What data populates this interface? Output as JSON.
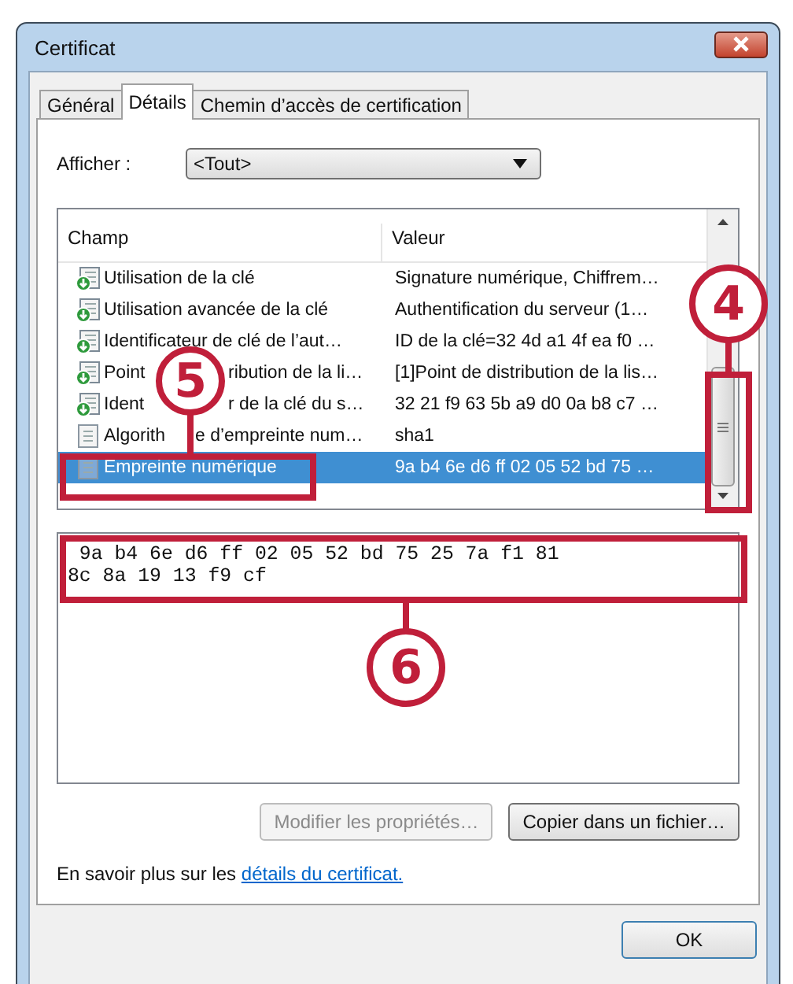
{
  "window": {
    "title": "Certificat"
  },
  "tabs": [
    {
      "label": "Général",
      "selected": false
    },
    {
      "label": "Détails",
      "selected": true
    },
    {
      "label": "Chemin d’accès de certification",
      "selected": false
    }
  ],
  "show": {
    "label": "Afficher :",
    "value": "<Tout>"
  },
  "list": {
    "columns": [
      "Champ",
      "Valeur"
    ],
    "rows": [
      {
        "field": "Utilisation de la clé",
        "value": "Signature numérique, Chiffrem…",
        "kind": "extension",
        "selected": false
      },
      {
        "field": "Utilisation avancée de la clé",
        "value": "Authentification du serveur (1…",
        "kind": "extension",
        "selected": false
      },
      {
        "field": "Identificateur de clé de l’aut…",
        "value": "ID de la clé=32 4d a1 4f ea f0 …",
        "kind": "extension",
        "selected": false
      },
      {
        "field_parts": [
          "Point",
          "ribution de la li…"
        ],
        "value": "[1]Point de distribution de la lis…",
        "kind": "extension",
        "selected": false
      },
      {
        "field_parts": [
          "Ident",
          "r de la clé du s…"
        ],
        "value": "32 21 f9 63 5b a9 d0 0a b8 c7 …",
        "kind": "extension",
        "selected": false
      },
      {
        "field_parts": [
          "Algorith",
          "e d’empreinte num…"
        ],
        "value": "sha1",
        "kind": "property",
        "selected": false
      },
      {
        "field": "Empreinte numérique",
        "value": "9a b4 6e d6 ff 02 05 52 bd 75 …",
        "kind": "property",
        "selected": true
      }
    ]
  },
  "detail_lines": [
    " 9a b4 6e d6 ff 02 05 52 bd 75 25 7a f1 81",
    "8c 8a 19 13 f9 cf"
  ],
  "buttons": [
    {
      "label": "Modifier les propriétés…",
      "disabled": true
    },
    {
      "label": "Copier dans un fichier…",
      "disabled": false
    }
  ],
  "learn_more": {
    "text": "En savoir plus sur les",
    "link": "détails du certificat."
  },
  "ok_button": "OK",
  "annotations": [
    {
      "number": "4"
    },
    {
      "number": "5"
    },
    {
      "number": "6"
    }
  ]
}
